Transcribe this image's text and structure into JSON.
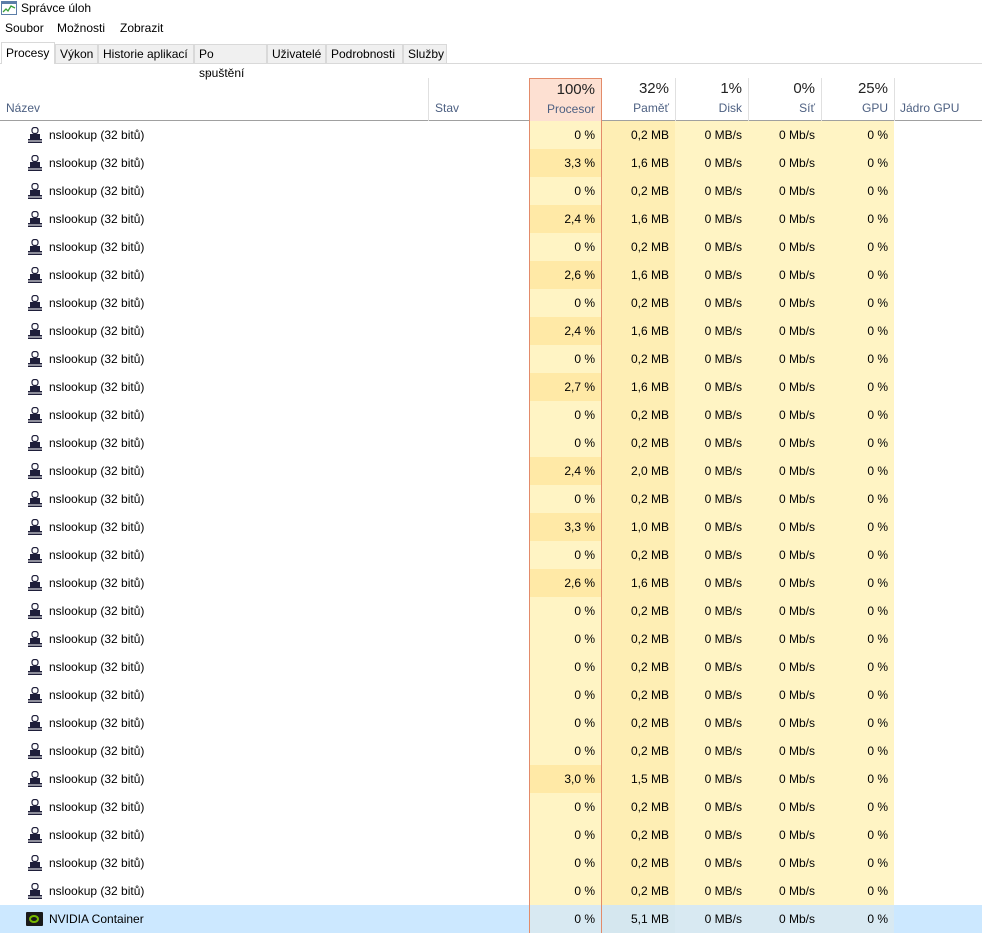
{
  "window": {
    "title": "Správce úloh"
  },
  "menu": [
    "Soubor",
    "Možnosti",
    "Zobrazit"
  ],
  "tabs": [
    "Procesy",
    "Výkon",
    "Historie aplikací",
    "Po spuštění",
    "Uživatelé",
    "Podrobnosti",
    "Služby"
  ],
  "active_tab": "Procesy",
  "columns": {
    "name": {
      "label": "Název"
    },
    "status": {
      "label": "Stav"
    },
    "cpu": {
      "pct": "100%",
      "label": "Procesor"
    },
    "memory": {
      "pct": "32%",
      "label": "Paměť"
    },
    "disk": {
      "pct": "1%",
      "label": "Disk"
    },
    "network": {
      "pct": "0%",
      "label": "Síť"
    },
    "gpu": {
      "pct": "25%",
      "label": "GPU"
    },
    "gpu_engine": {
      "label": "Jádro GPU"
    }
  },
  "colors": {
    "heat_light": "#fff4c4",
    "heat_medium": "#ffe9a6",
    "heat_medium_alt": "#feeeb4",
    "cpu_high": "#f4a17d",
    "selected": "#cce8ff",
    "nvidia_green": "#76b900"
  },
  "rows": [
    {
      "name": "nslookup (32 bitů)",
      "cpu": "0 %",
      "mem": "0,2 MB",
      "disk": "0 MB/s",
      "net": "0 Mb/s",
      "gpu": "0 %"
    },
    {
      "name": "nslookup (32 bitů)",
      "cpu": "3,3 %",
      "mem": "1,6 MB",
      "disk": "0 MB/s",
      "net": "0 Mb/s",
      "gpu": "0 %"
    },
    {
      "name": "nslookup (32 bitů)",
      "cpu": "0 %",
      "mem": "0,2 MB",
      "disk": "0 MB/s",
      "net": "0 Mb/s",
      "gpu": "0 %"
    },
    {
      "name": "nslookup (32 bitů)",
      "cpu": "2,4 %",
      "mem": "1,6 MB",
      "disk": "0 MB/s",
      "net": "0 Mb/s",
      "gpu": "0 %"
    },
    {
      "name": "nslookup (32 bitů)",
      "cpu": "0 %",
      "mem": "0,2 MB",
      "disk": "0 MB/s",
      "net": "0 Mb/s",
      "gpu": "0 %"
    },
    {
      "name": "nslookup (32 bitů)",
      "cpu": "2,6 %",
      "mem": "1,6 MB",
      "disk": "0 MB/s",
      "net": "0 Mb/s",
      "gpu": "0 %"
    },
    {
      "name": "nslookup (32 bitů)",
      "cpu": "0 %",
      "mem": "0,2 MB",
      "disk": "0 MB/s",
      "net": "0 Mb/s",
      "gpu": "0 %"
    },
    {
      "name": "nslookup (32 bitů)",
      "cpu": "2,4 %",
      "mem": "1,6 MB",
      "disk": "0 MB/s",
      "net": "0 Mb/s",
      "gpu": "0 %"
    },
    {
      "name": "nslookup (32 bitů)",
      "cpu": "0 %",
      "mem": "0,2 MB",
      "disk": "0 MB/s",
      "net": "0 Mb/s",
      "gpu": "0 %"
    },
    {
      "name": "nslookup (32 bitů)",
      "cpu": "2,7 %",
      "mem": "1,6 MB",
      "disk": "0 MB/s",
      "net": "0 Mb/s",
      "gpu": "0 %"
    },
    {
      "name": "nslookup (32 bitů)",
      "cpu": "0 %",
      "mem": "0,2 MB",
      "disk": "0 MB/s",
      "net": "0 Mb/s",
      "gpu": "0 %"
    },
    {
      "name": "nslookup (32 bitů)",
      "cpu": "0 %",
      "mem": "0,2 MB",
      "disk": "0 MB/s",
      "net": "0 Mb/s",
      "gpu": "0 %"
    },
    {
      "name": "nslookup (32 bitů)",
      "cpu": "2,4 %",
      "mem": "2,0 MB",
      "disk": "0 MB/s",
      "net": "0 Mb/s",
      "gpu": "0 %"
    },
    {
      "name": "nslookup (32 bitů)",
      "cpu": "0 %",
      "mem": "0,2 MB",
      "disk": "0 MB/s",
      "net": "0 Mb/s",
      "gpu": "0 %"
    },
    {
      "name": "nslookup (32 bitů)",
      "cpu": "3,3 %",
      "mem": "1,0 MB",
      "disk": "0 MB/s",
      "net": "0 Mb/s",
      "gpu": "0 %"
    },
    {
      "name": "nslookup (32 bitů)",
      "cpu": "0 %",
      "mem": "0,2 MB",
      "disk": "0 MB/s",
      "net": "0 Mb/s",
      "gpu": "0 %"
    },
    {
      "name": "nslookup (32 bitů)",
      "cpu": "2,6 %",
      "mem": "1,6 MB",
      "disk": "0 MB/s",
      "net": "0 Mb/s",
      "gpu": "0 %"
    },
    {
      "name": "nslookup (32 bitů)",
      "cpu": "0 %",
      "mem": "0,2 MB",
      "disk": "0 MB/s",
      "net": "0 Mb/s",
      "gpu": "0 %"
    },
    {
      "name": "nslookup (32 bitů)",
      "cpu": "0 %",
      "mem": "0,2 MB",
      "disk": "0 MB/s",
      "net": "0 Mb/s",
      "gpu": "0 %"
    },
    {
      "name": "nslookup (32 bitů)",
      "cpu": "0 %",
      "mem": "0,2 MB",
      "disk": "0 MB/s",
      "net": "0 Mb/s",
      "gpu": "0 %"
    },
    {
      "name": "nslookup (32 bitů)",
      "cpu": "0 %",
      "mem": "0,2 MB",
      "disk": "0 MB/s",
      "net": "0 Mb/s",
      "gpu": "0 %"
    },
    {
      "name": "nslookup (32 bitů)",
      "cpu": "0 %",
      "mem": "0,2 MB",
      "disk": "0 MB/s",
      "net": "0 Mb/s",
      "gpu": "0 %"
    },
    {
      "name": "nslookup (32 bitů)",
      "cpu": "0 %",
      "mem": "0,2 MB",
      "disk": "0 MB/s",
      "net": "0 Mb/s",
      "gpu": "0 %"
    },
    {
      "name": "nslookup (32 bitů)",
      "cpu": "3,0 %",
      "mem": "1,5 MB",
      "disk": "0 MB/s",
      "net": "0 Mb/s",
      "gpu": "0 %"
    },
    {
      "name": "nslookup (32 bitů)",
      "cpu": "0 %",
      "mem": "0,2 MB",
      "disk": "0 MB/s",
      "net": "0 Mb/s",
      "gpu": "0 %"
    },
    {
      "name": "nslookup (32 bitů)",
      "cpu": "0 %",
      "mem": "0,2 MB",
      "disk": "0 MB/s",
      "net": "0 Mb/s",
      "gpu": "0 %"
    },
    {
      "name": "nslookup (32 bitů)",
      "cpu": "0 %",
      "mem": "0,2 MB",
      "disk": "0 MB/s",
      "net": "0 Mb/s",
      "gpu": "0 %"
    },
    {
      "name": "nslookup (32 bitů)",
      "cpu": "0 %",
      "mem": "0,2 MB",
      "disk": "0 MB/s",
      "net": "0 Mb/s",
      "gpu": "0 %"
    },
    {
      "name": "NVIDIA Container",
      "cpu": "0 %",
      "mem": "5,1 MB",
      "disk": "0 MB/s",
      "net": "0 Mb/s",
      "gpu": "0 %",
      "icon": "nvidia-icon",
      "selected": true
    }
  ]
}
